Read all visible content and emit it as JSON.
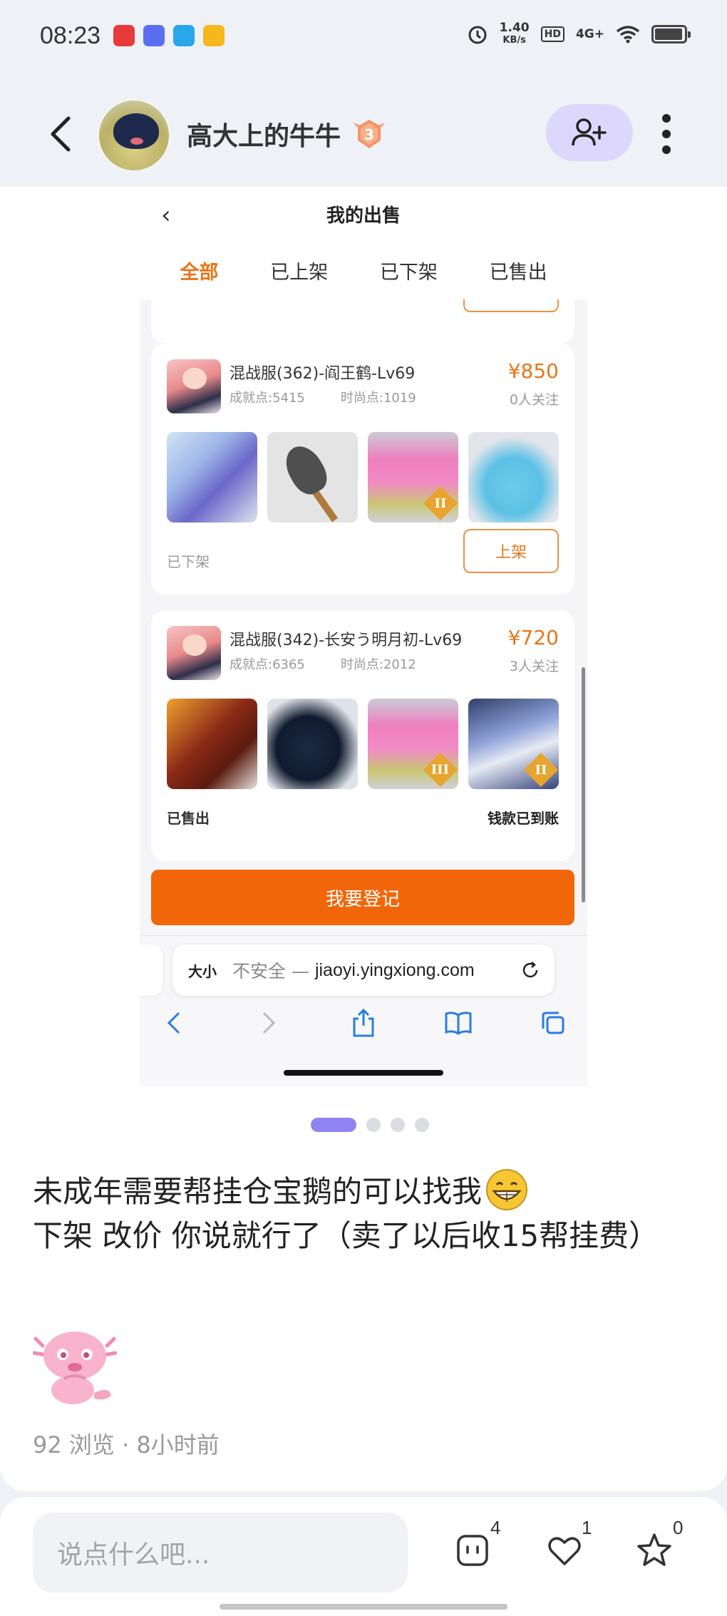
{
  "status_bar": {
    "time": "08:23",
    "net_speed_value": "1.40",
    "net_speed_unit": "KB/s",
    "hd": "HD",
    "network": "4G+",
    "app_icon_colors": [
      "#e83a3a",
      "#5a6ff0",
      "#2aa6ea",
      "#f4b81c"
    ]
  },
  "header": {
    "username": "高大上的牛牛",
    "level": "3"
  },
  "screenshot": {
    "title": "我的出售",
    "tabs": [
      {
        "label": "全部",
        "active": true
      },
      {
        "label": "已上架",
        "active": false
      },
      {
        "label": "已下架",
        "active": false
      },
      {
        "label": "已售出",
        "active": false
      }
    ],
    "listings": [
      {
        "name": "混战服(362)-阎王鹤-Lv69",
        "achievement": "成就点:5415",
        "fashion": "时尚点:1019",
        "price": "¥850",
        "follows": "0人关注",
        "status": "已下架",
        "action": "上架",
        "tier_badges": [
          "",
          "",
          "II",
          ""
        ]
      },
      {
        "name": "混战服(342)-长安う明月初-Lv69",
        "achievement": "成就点:6365",
        "fashion": "时尚点:2012",
        "price": "¥720",
        "follows": "3人关注",
        "status": "已售出",
        "note": "钱款已到账",
        "tier_badges": [
          "",
          "",
          "III",
          "II"
        ]
      }
    ],
    "register_button": "我要登记",
    "browser": {
      "text_size": "大小",
      "insecure": "不安全 —",
      "domain": "jiaoyi.yingxiong.com"
    }
  },
  "carousel": {
    "total": 4,
    "active_index": 0
  },
  "post": {
    "line1": "未成年需要帮挂仓宝鹅的可以找我",
    "line2": "下架 改价 你说就行了（卖了以后收15帮挂费）",
    "views": "92 浏览",
    "separator": "·",
    "time_ago": "8小时前"
  },
  "bottom_bar": {
    "comment_placeholder": "说点什么吧...",
    "comment_count": "4",
    "like_count": "1",
    "favorite_count": "0"
  },
  "colors": {
    "accent_orange": "#e8751a",
    "register_orange": "#f2660a",
    "follow_bg": "#ddd8fb",
    "dot_active": "#8f83f2"
  }
}
